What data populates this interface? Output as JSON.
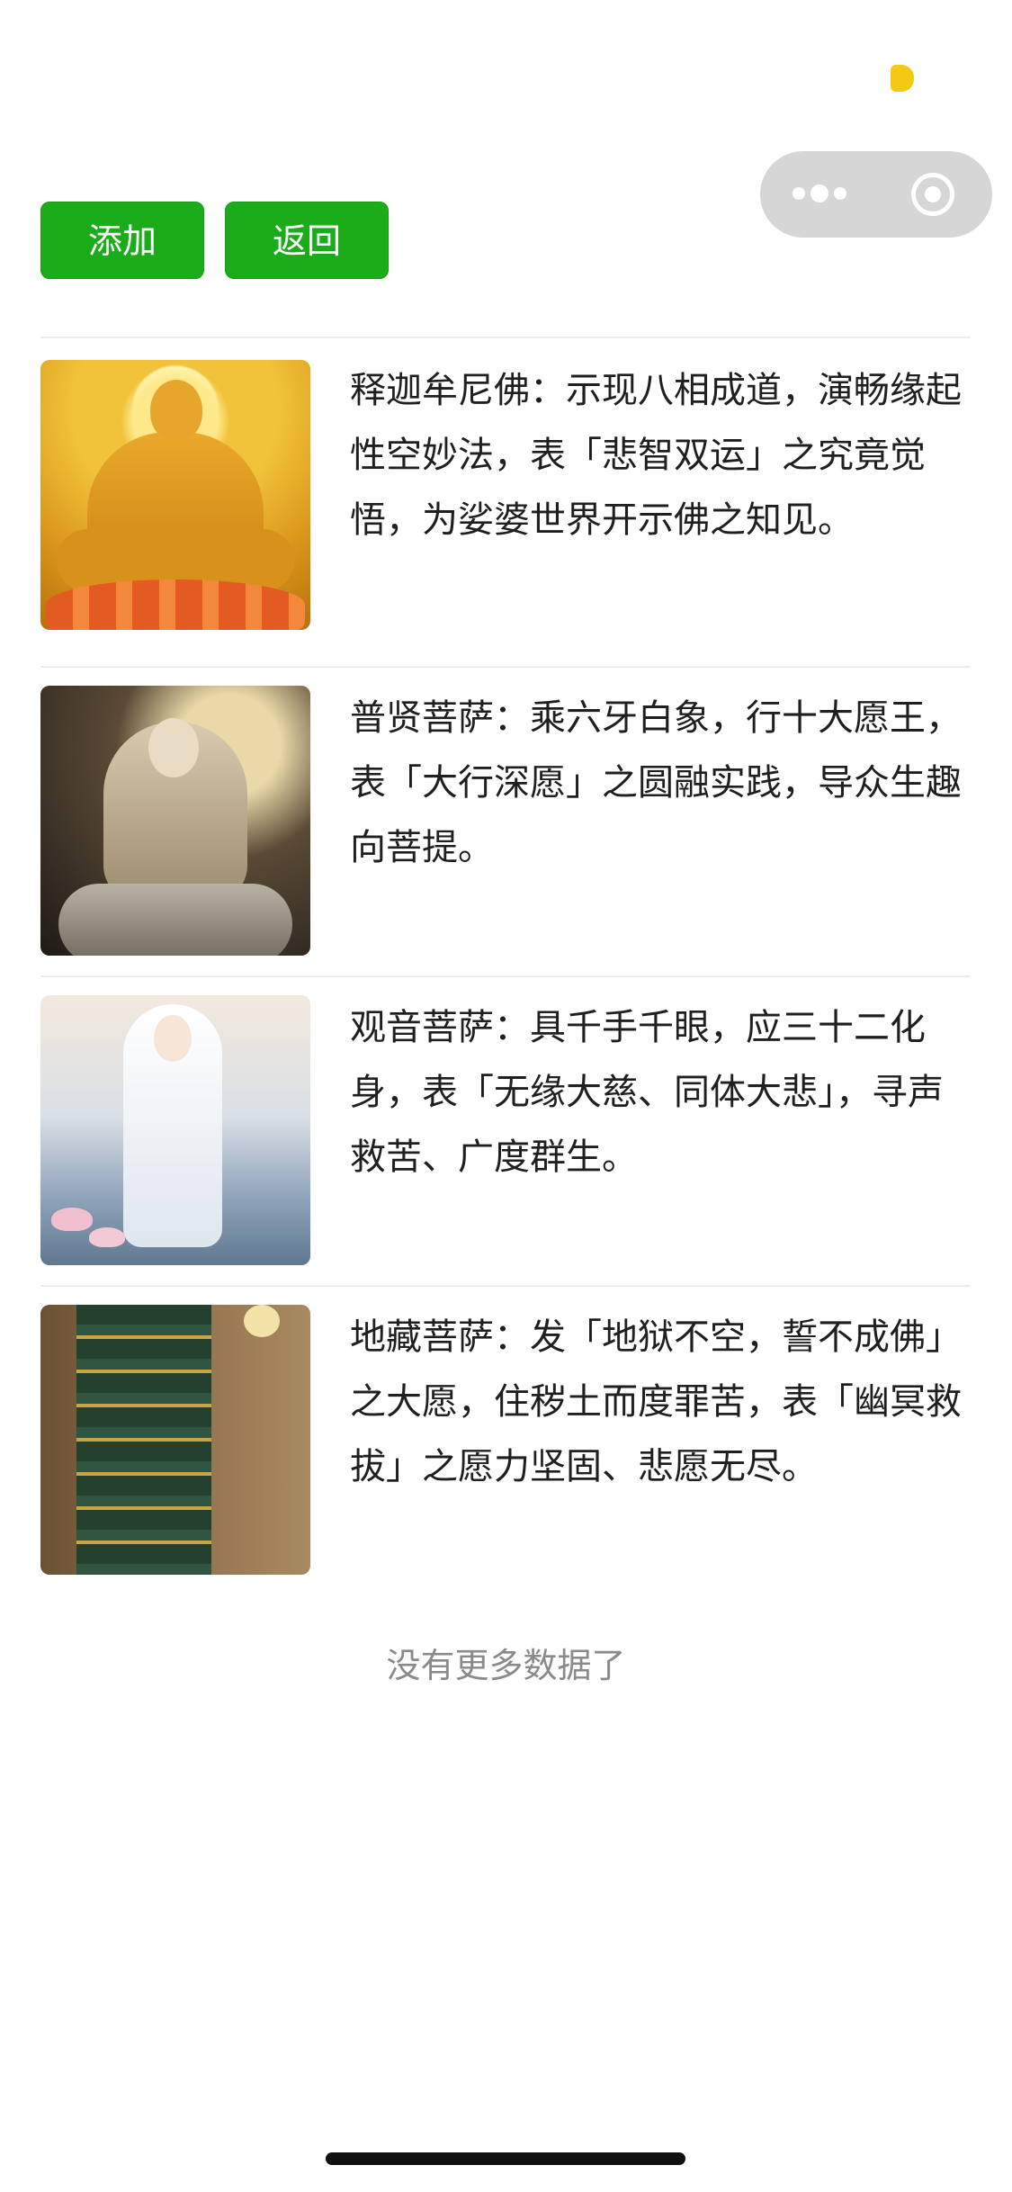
{
  "actions": {
    "add_label": "添加",
    "back_label": "返回"
  },
  "items": [
    {
      "image_icon": "shakyamuni-buddha-painting",
      "text": "释迦牟尼佛：示现八相成道，演畅缘起性空妙法，表「悲智双运」之究竟觉悟，为娑婆世界开示佛之知见。"
    },
    {
      "image_icon": "samantabhadra-bodhisattva-painting",
      "text": "普贤菩萨：乘六牙白象，行十大愿王，表「大行深愿」之圆融实践，导众生趣向菩提。"
    },
    {
      "image_icon": "guanyin-bodhisattva-painting",
      "text": "观音菩萨：具千手千眼，应三十二化身，表「无缘大慈、同体大悲」，寻声救苦、广度群生。"
    },
    {
      "image_icon": "ksitigarbha-bodhisattva-painting",
      "text": "地藏菩萨：发「地狱不空，誓不成佛」之大愿，住秽土而度罪苦，表「幽冥救拔」之愿力坚固、悲愿无尽。"
    }
  ],
  "footer": {
    "no_more_text": "没有更多数据了"
  },
  "colors": {
    "primary_button": "#1aad19",
    "status_indicator": "#f6c816",
    "capsule": "#d6d6d6"
  }
}
